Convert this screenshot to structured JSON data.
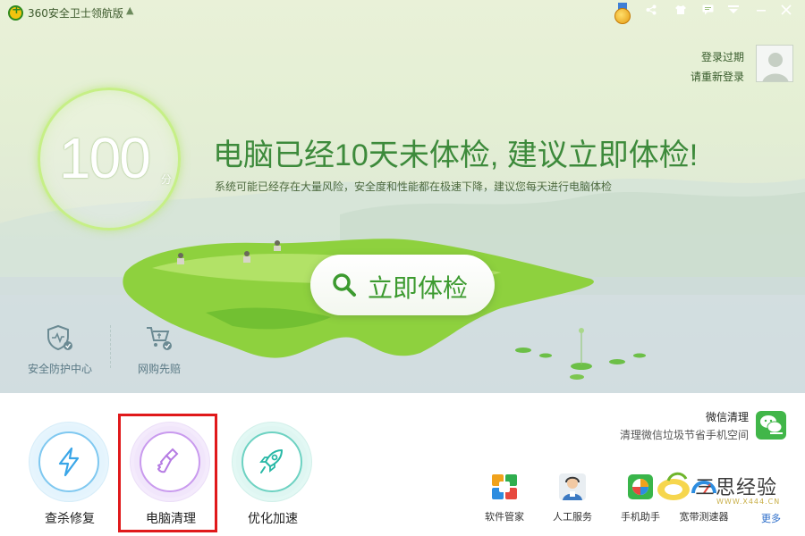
{
  "app": {
    "title": "360安全卫士领航版"
  },
  "login": {
    "line1": "登录过期",
    "line2": "请重新登录"
  },
  "score": {
    "value": "100",
    "unit": "分"
  },
  "headline": "电脑已经10天未体检, 建议立即体检!",
  "subline": "系统可能已经存在大量风险，安全度和性能都在极速下降，建议您每天进行电脑体检",
  "check_button": {
    "label": "立即体检"
  },
  "hero_shortcuts": [
    {
      "label": "安全防护中心",
      "icon": "shield-icon"
    },
    {
      "label": "网购先赔",
      "icon": "cart-icon"
    }
  ],
  "tools": [
    {
      "label": "查杀修复",
      "icon": "lightning-icon",
      "color": "#3aa6e8"
    },
    {
      "label": "电脑清理",
      "icon": "broom-icon",
      "color": "#b57be3"
    },
    {
      "label": "优化加速",
      "icon": "rocket-icon",
      "color": "#28b8a6"
    }
  ],
  "wechat": {
    "title": "微信清理",
    "subtitle": "清理微信垃圾节省手机空间"
  },
  "apps": [
    {
      "label": "软件管家",
      "icon": "software-manager-icon"
    },
    {
      "label": "人工服务",
      "icon": "support-agent-icon"
    },
    {
      "label": "手机助手",
      "icon": "phone-assistant-icon"
    },
    {
      "label": "宽带测速器",
      "icon": "speed-test-icon"
    }
  ],
  "more": "更多",
  "watermark": {
    "text": "三思经验",
    "url": "WWW.X444.CN"
  },
  "colors": {
    "accent_green": "#3c9a2f",
    "highlight_red": "#e0191b"
  }
}
